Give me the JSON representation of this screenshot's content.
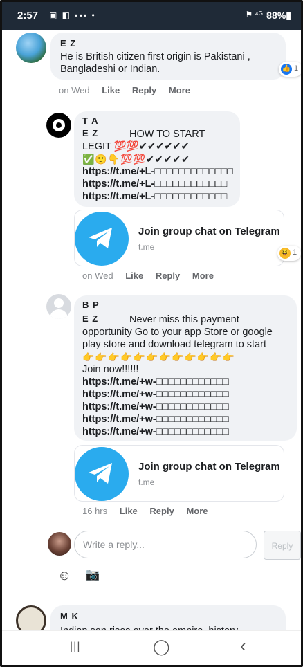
{
  "status_bar": {
    "time": "2:57",
    "left_icons": "▣ ◧ ▪▪▪ •",
    "right_icons": "⚑ ⁴ᴳ ıl",
    "battery": "88%▮"
  },
  "comments": [
    {
      "author": "E Z",
      "text": "He is British citizen first origin is Pakistani , Bangladeshi or Indian.",
      "reactions": {
        "type": "like",
        "icon": "👍",
        "count": "1"
      },
      "time": "on Wed",
      "actions": [
        "Like",
        "Reply",
        "More"
      ]
    },
    {
      "author": "T A",
      "mention": "E Z",
      "text": "HOW TO START",
      "text2": "LEGIT 💯💯✔✔✔✔✔✔",
      "emoji_line": "✅🙂👇💯💯✔✔✔✔✔",
      "links": [
        "https://t.me/+L-□□□□□□□□□□□□□",
        "https://t.me/+L-□□□□□□□□□□□□",
        "https://t.me/+L-□□□□□□□□□□□□"
      ],
      "card": {
        "title": "Join group chat on Telegram",
        "domain": "t.me"
      },
      "reactions": {
        "type": "haha",
        "icon": "😆",
        "count": "1"
      },
      "time": "on Wed",
      "actions": [
        "Like",
        "Reply",
        "More"
      ]
    },
    {
      "author": "B P",
      "mention": "E Z",
      "text": "Never miss this payment",
      "text_lines": [
        "opportunity Go to your app Store or google",
        "play store and download telegram to start"
      ],
      "emoji_line": "👉👉👉👉👉👉👉👉👉👉👉👉",
      "join_text": "Join now!!!!!!",
      "links": [
        "https://t.me/+w-□□□□□□□□□□□□",
        "https://t.me/+w-□□□□□□□□□□□□",
        "https://t.me/+w-□□□□□□□□□□□□",
        "https://t.me/+w-□□□□□□□□□□□□",
        "https://t.me/+w-□□□□□□□□□□□□"
      ],
      "card": {
        "title": "Join group chat on Telegram",
        "domain": "t.me"
      },
      "time": "16 hrs",
      "actions": [
        "Like",
        "Reply",
        "More"
      ]
    },
    {
      "author": "M K",
      "text": "Indian son rises over the empire, history"
    }
  ],
  "reply_box": {
    "placeholder": "Write a reply...",
    "button": "Reply",
    "emoji_icon": "☺",
    "camera_icon": "📷"
  },
  "nav": {
    "recents": "|||",
    "home": "◯",
    "back": "‹"
  }
}
